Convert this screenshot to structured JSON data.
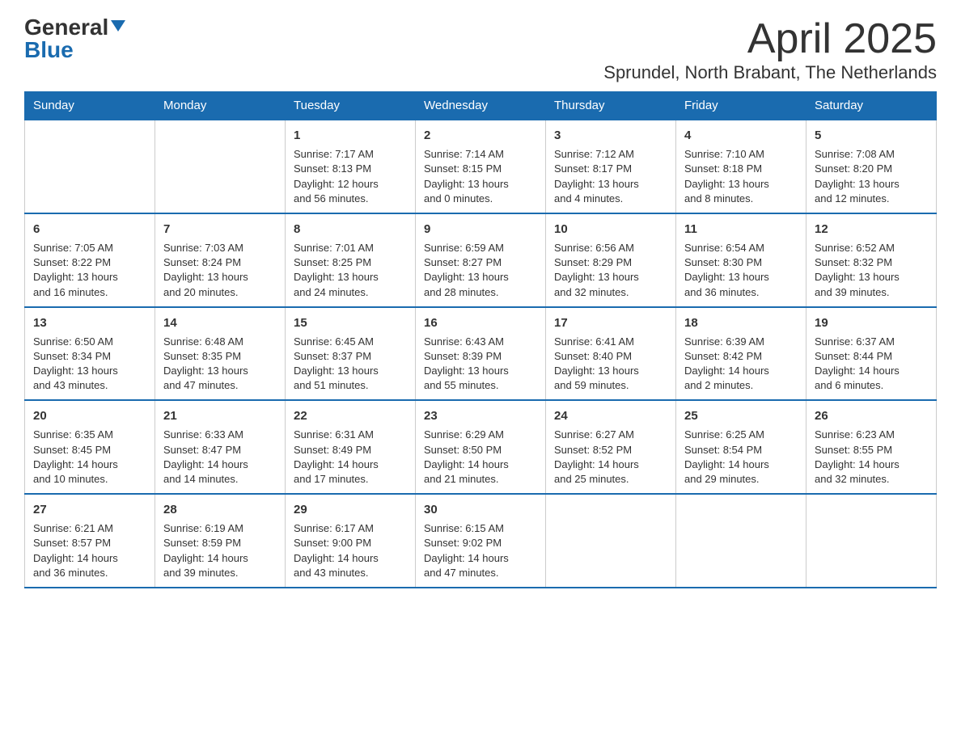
{
  "logo": {
    "general": "General",
    "blue": "Blue"
  },
  "title": {
    "month": "April 2025",
    "location": "Sprundel, North Brabant, The Netherlands"
  },
  "headers": [
    "Sunday",
    "Monday",
    "Tuesday",
    "Wednesday",
    "Thursday",
    "Friday",
    "Saturday"
  ],
  "weeks": [
    [
      {
        "day": "",
        "info": ""
      },
      {
        "day": "",
        "info": ""
      },
      {
        "day": "1",
        "info": "Sunrise: 7:17 AM\nSunset: 8:13 PM\nDaylight: 12 hours\nand 56 minutes."
      },
      {
        "day": "2",
        "info": "Sunrise: 7:14 AM\nSunset: 8:15 PM\nDaylight: 13 hours\nand 0 minutes."
      },
      {
        "day": "3",
        "info": "Sunrise: 7:12 AM\nSunset: 8:17 PM\nDaylight: 13 hours\nand 4 minutes."
      },
      {
        "day": "4",
        "info": "Sunrise: 7:10 AM\nSunset: 8:18 PM\nDaylight: 13 hours\nand 8 minutes."
      },
      {
        "day": "5",
        "info": "Sunrise: 7:08 AM\nSunset: 8:20 PM\nDaylight: 13 hours\nand 12 minutes."
      }
    ],
    [
      {
        "day": "6",
        "info": "Sunrise: 7:05 AM\nSunset: 8:22 PM\nDaylight: 13 hours\nand 16 minutes."
      },
      {
        "day": "7",
        "info": "Sunrise: 7:03 AM\nSunset: 8:24 PM\nDaylight: 13 hours\nand 20 minutes."
      },
      {
        "day": "8",
        "info": "Sunrise: 7:01 AM\nSunset: 8:25 PM\nDaylight: 13 hours\nand 24 minutes."
      },
      {
        "day": "9",
        "info": "Sunrise: 6:59 AM\nSunset: 8:27 PM\nDaylight: 13 hours\nand 28 minutes."
      },
      {
        "day": "10",
        "info": "Sunrise: 6:56 AM\nSunset: 8:29 PM\nDaylight: 13 hours\nand 32 minutes."
      },
      {
        "day": "11",
        "info": "Sunrise: 6:54 AM\nSunset: 8:30 PM\nDaylight: 13 hours\nand 36 minutes."
      },
      {
        "day": "12",
        "info": "Sunrise: 6:52 AM\nSunset: 8:32 PM\nDaylight: 13 hours\nand 39 minutes."
      }
    ],
    [
      {
        "day": "13",
        "info": "Sunrise: 6:50 AM\nSunset: 8:34 PM\nDaylight: 13 hours\nand 43 minutes."
      },
      {
        "day": "14",
        "info": "Sunrise: 6:48 AM\nSunset: 8:35 PM\nDaylight: 13 hours\nand 47 minutes."
      },
      {
        "day": "15",
        "info": "Sunrise: 6:45 AM\nSunset: 8:37 PM\nDaylight: 13 hours\nand 51 minutes."
      },
      {
        "day": "16",
        "info": "Sunrise: 6:43 AM\nSunset: 8:39 PM\nDaylight: 13 hours\nand 55 minutes."
      },
      {
        "day": "17",
        "info": "Sunrise: 6:41 AM\nSunset: 8:40 PM\nDaylight: 13 hours\nand 59 minutes."
      },
      {
        "day": "18",
        "info": "Sunrise: 6:39 AM\nSunset: 8:42 PM\nDaylight: 14 hours\nand 2 minutes."
      },
      {
        "day": "19",
        "info": "Sunrise: 6:37 AM\nSunset: 8:44 PM\nDaylight: 14 hours\nand 6 minutes."
      }
    ],
    [
      {
        "day": "20",
        "info": "Sunrise: 6:35 AM\nSunset: 8:45 PM\nDaylight: 14 hours\nand 10 minutes."
      },
      {
        "day": "21",
        "info": "Sunrise: 6:33 AM\nSunset: 8:47 PM\nDaylight: 14 hours\nand 14 minutes."
      },
      {
        "day": "22",
        "info": "Sunrise: 6:31 AM\nSunset: 8:49 PM\nDaylight: 14 hours\nand 17 minutes."
      },
      {
        "day": "23",
        "info": "Sunrise: 6:29 AM\nSunset: 8:50 PM\nDaylight: 14 hours\nand 21 minutes."
      },
      {
        "day": "24",
        "info": "Sunrise: 6:27 AM\nSunset: 8:52 PM\nDaylight: 14 hours\nand 25 minutes."
      },
      {
        "day": "25",
        "info": "Sunrise: 6:25 AM\nSunset: 8:54 PM\nDaylight: 14 hours\nand 29 minutes."
      },
      {
        "day": "26",
        "info": "Sunrise: 6:23 AM\nSunset: 8:55 PM\nDaylight: 14 hours\nand 32 minutes."
      }
    ],
    [
      {
        "day": "27",
        "info": "Sunrise: 6:21 AM\nSunset: 8:57 PM\nDaylight: 14 hours\nand 36 minutes."
      },
      {
        "day": "28",
        "info": "Sunrise: 6:19 AM\nSunset: 8:59 PM\nDaylight: 14 hours\nand 39 minutes."
      },
      {
        "day": "29",
        "info": "Sunrise: 6:17 AM\nSunset: 9:00 PM\nDaylight: 14 hours\nand 43 minutes."
      },
      {
        "day": "30",
        "info": "Sunrise: 6:15 AM\nSunset: 9:02 PM\nDaylight: 14 hours\nand 47 minutes."
      },
      {
        "day": "",
        "info": ""
      },
      {
        "day": "",
        "info": ""
      },
      {
        "day": "",
        "info": ""
      }
    ]
  ]
}
